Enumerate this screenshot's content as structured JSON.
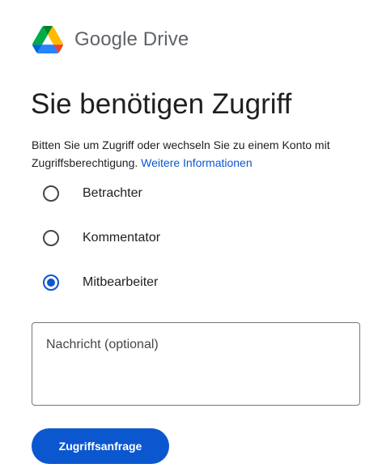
{
  "header": {
    "logo_icon": "google-drive-icon",
    "brand": "Google Drive"
  },
  "main": {
    "title": "Sie benötigen Zugriff",
    "description": "Bitten Sie um Zugriff oder wechseln Sie zu einem Konto mit Zugriffsberechtigung.",
    "learn_more_link": "Weitere Informationen"
  },
  "access_options": [
    {
      "label": "Betrachter",
      "selected": false
    },
    {
      "label": "Kommentator",
      "selected": false
    },
    {
      "label": "Mitbearbeiter",
      "selected": true
    }
  ],
  "message": {
    "value": "",
    "placeholder": "Nachricht (optional)"
  },
  "submit_label": "Zugriffsanfrage",
  "colors": {
    "accent": "#0b57d0",
    "link": "#0b57d0",
    "drive_green": "#0f9d58",
    "drive_yellow": "#f4b400",
    "drive_blue": "#4285f4",
    "drive_dark_green": "#00832d",
    "drive_red": "#ea4335"
  }
}
